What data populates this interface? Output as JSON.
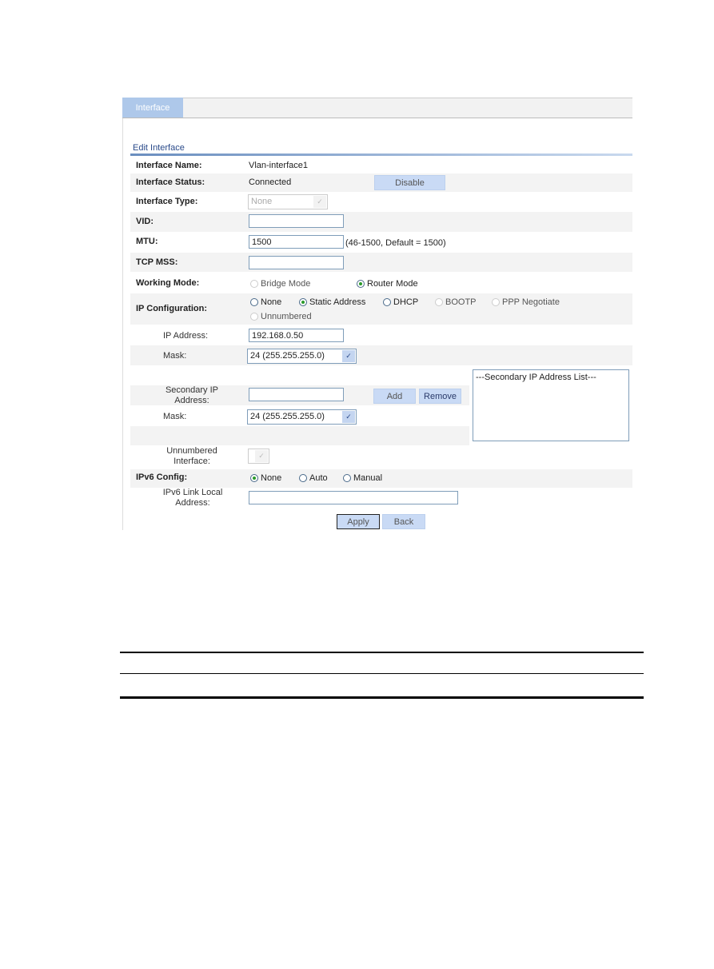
{
  "tab": "Interface",
  "section": "Edit Interface",
  "fields": {
    "name_label": "Interface Name:",
    "name_value": "Vlan-interface1",
    "status_label": "Interface Status:",
    "status_value": "Connected",
    "disable_btn": "Disable",
    "type_label": "Interface Type:",
    "type_value": "None",
    "vid_label": "VID:",
    "vid_value": "",
    "mtu_label": "MTU:",
    "mtu_value": "1500",
    "mtu_hint": "(46-1500, Default = 1500)",
    "tcpmss_label": "TCP MSS:",
    "tcpmss_value": "",
    "mode_label": "Working Mode:",
    "mode_options": [
      "Bridge Mode",
      "Router Mode"
    ],
    "mode_selected": "Router Mode",
    "ipconf_label": "IP Configuration:",
    "ipconf_options": [
      "None",
      "Static Address",
      "DHCP",
      "BOOTP",
      "PPP Negotiate",
      "Unnumbered"
    ],
    "ipconf_selected": "Static Address",
    "ip_label": "IP Address:",
    "ip_value": "192.168.0.50",
    "mask_label": "Mask:",
    "mask_value": "24 (255.255.255.0)",
    "sec_label": "Secondary IP Address:",
    "sec_value": "",
    "add_btn": "Add",
    "remove_btn": "Remove",
    "sec_list": "---Secondary IP Address List---",
    "mask2_label": "Mask:",
    "mask2_value": "24 (255.255.255.0)",
    "unnum_label": "Unnumbered Interface:",
    "ipv6_label": "IPv6 Config:",
    "ipv6_options": [
      "None",
      "Auto",
      "Manual"
    ],
    "ipv6_selected": "None",
    "ipv6ll_label": "IPv6 Link Local Address:",
    "ipv6ll_value": ""
  },
  "buttons": {
    "apply": "Apply",
    "back": "Back"
  }
}
